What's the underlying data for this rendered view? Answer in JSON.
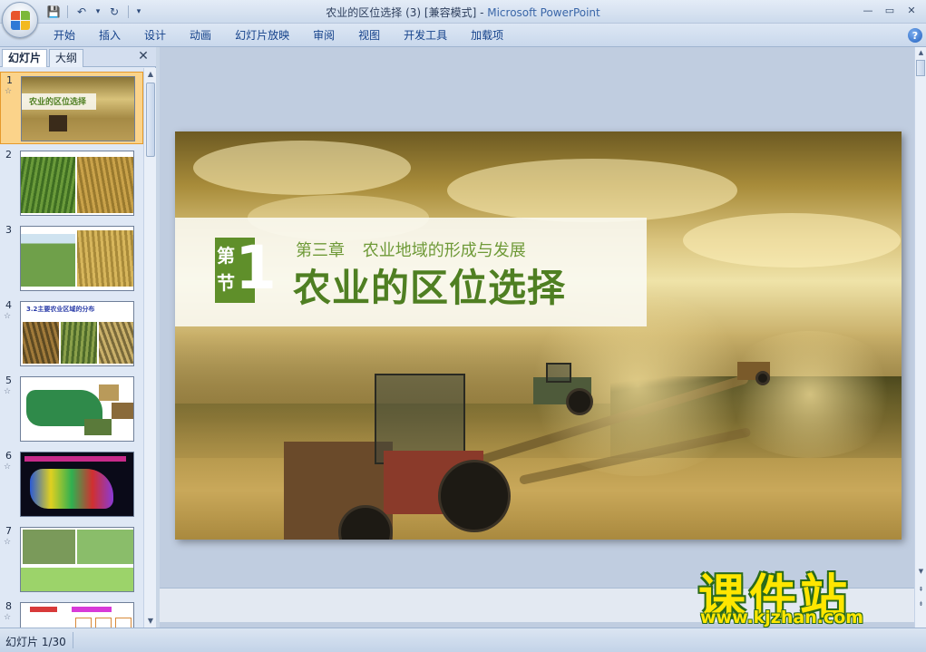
{
  "window": {
    "title": "农业的区位选择 (3) [兼容模式]",
    "title_sep": " - ",
    "app_name": "Microsoft PowerPoint",
    "minimize": "—",
    "restore": "▭",
    "close": "✕"
  },
  "quick_access": {
    "save_icon": "💾",
    "undo_icon": "↶",
    "undo_dd": "▾",
    "redo_icon": "↻",
    "customize": "▾"
  },
  "ribbon": {
    "tabs": [
      "开始",
      "插入",
      "设计",
      "动画",
      "幻灯片放映",
      "审阅",
      "视图",
      "开发工具",
      "加载项"
    ],
    "help": "?"
  },
  "left_panel": {
    "tab_slides": "幻灯片",
    "tab_outline": "大纲",
    "close": "✕",
    "scroll_up": "▲",
    "scroll_down": "▼",
    "thumbnails": [
      {
        "num": "1",
        "star": "☆",
        "selected": true
      },
      {
        "num": "2",
        "star": ""
      },
      {
        "num": "3",
        "star": ""
      },
      {
        "num": "4",
        "star": "☆"
      },
      {
        "num": "5",
        "star": "☆"
      },
      {
        "num": "6",
        "star": "☆"
      },
      {
        "num": "7",
        "star": "☆"
      },
      {
        "num": "8",
        "star": "☆"
      }
    ],
    "thumb1_title": "农业的区位选择",
    "thumb4_title": "3.2主要农业区域的分布"
  },
  "slide": {
    "badge_top": "第",
    "badge_bottom": "节",
    "badge_number": "1",
    "subtitle": "第三章 农业地域的形成与发展",
    "main_title": "农业的区位选择"
  },
  "editor_scroll": {
    "up": "▲",
    "down": "▼",
    "prev_slide": "⇞",
    "next_slide": "⇟"
  },
  "status_bar": {
    "slide_indicator": "幻灯片 1/30"
  },
  "watermark": {
    "brand": "课件站",
    "url": "www.kjzhan.com"
  },
  "colors": {
    "accent_green": "#5f8f2a",
    "selection_orange": "#fbd38a",
    "ribbon_text": "#15428b"
  }
}
